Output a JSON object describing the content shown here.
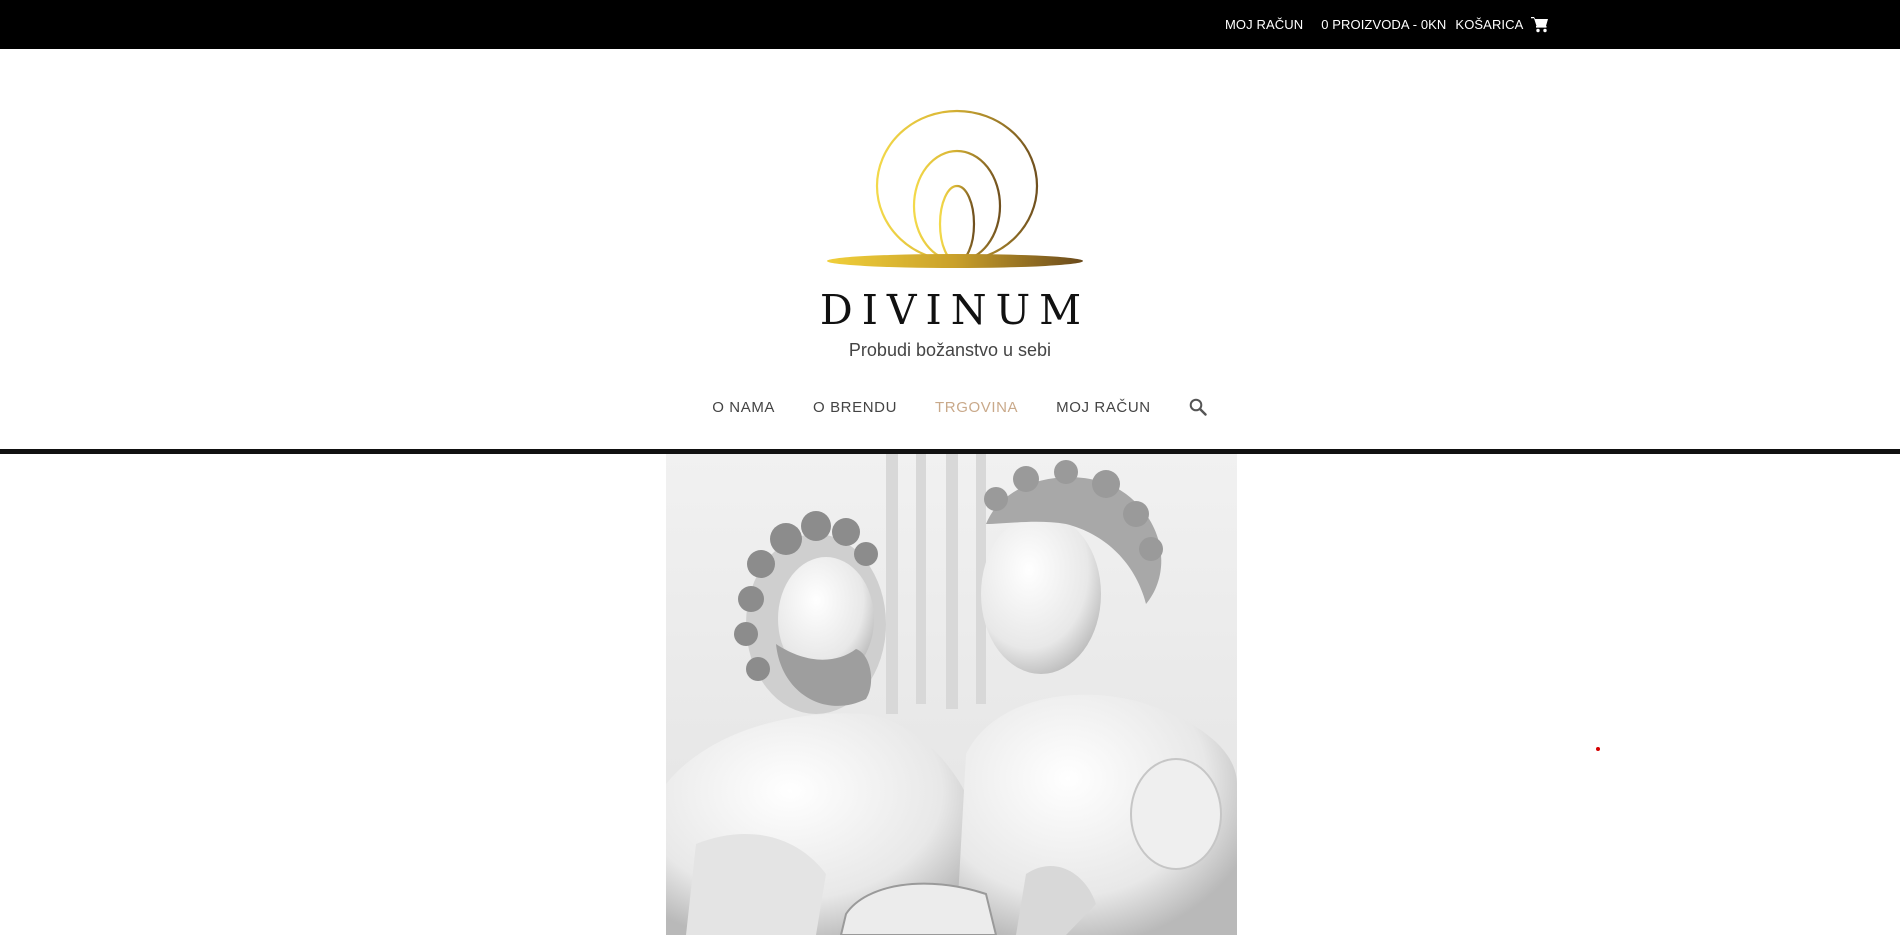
{
  "topbar": {
    "account_label": "MOJ RAČUN",
    "cart_summary": "0 PROIZVODA - 0KN",
    "cart_label": "KOŠARICA",
    "cart_icon": "shopping-cart-icon"
  },
  "brand": {
    "name": "DIVINUM",
    "tagline": "Probudi božanstvo u sebi",
    "colors": {
      "gold_light": "#f3d94a",
      "gold_dark": "#7a5a22"
    }
  },
  "nav": {
    "items": [
      {
        "label": "O NAMA",
        "active": false
      },
      {
        "label": "O BRENDU",
        "active": false
      },
      {
        "label": "TRGOVINA",
        "active": true
      },
      {
        "label": "MOJ RAČUN",
        "active": false
      }
    ],
    "search_icon": "search-icon",
    "active_color": "#c9a98a"
  },
  "hero": {
    "image": "marble-statues-image"
  }
}
